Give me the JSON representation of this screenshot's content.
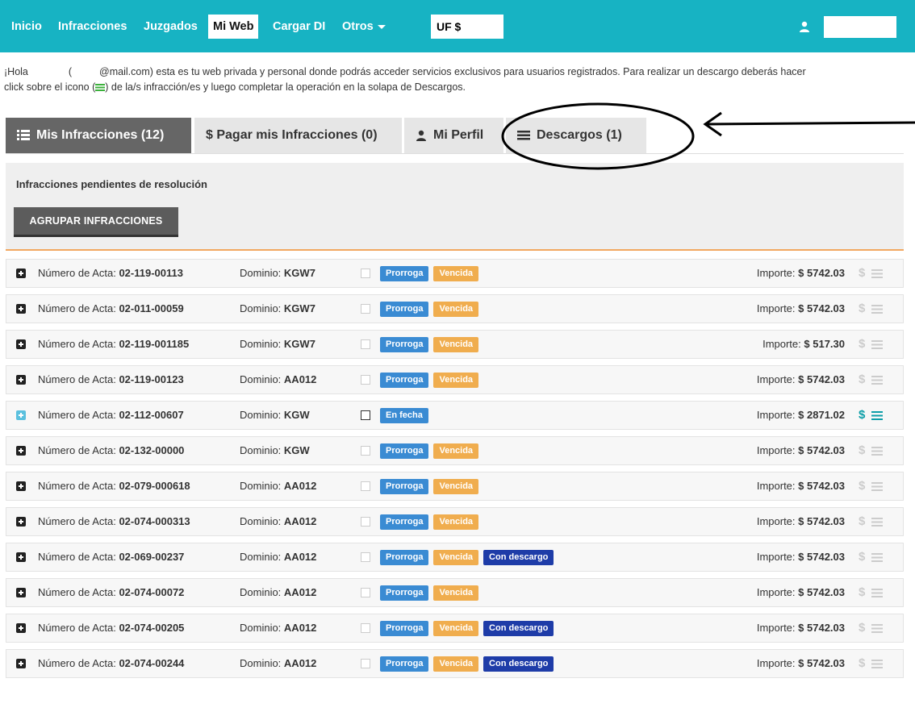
{
  "nav": {
    "items": [
      "Inicio",
      "Infracciones",
      "Juzgados",
      "Mi Web",
      "Cargar DI",
      "Otros"
    ],
    "uf_label": "UF $"
  },
  "intro": {
    "line1_a": "¡Hola",
    "line1_b": "(",
    "line1_c": "@mail.com) esta es tu web privada y personal donde podrás acceder servicios exclusivos para usuarios registrados. Para realizar un descargo deberás hacer",
    "line2_a": "click sobre el icono (",
    "line2_b": ") de la/s infracción/es y luego completar la operación en la solapa de Descargos."
  },
  "tabs": [
    {
      "label": "Mis Infracciones (12)"
    },
    {
      "label": "$ Pagar mis Infracciones (0)"
    },
    {
      "label": "Mi Perfil"
    },
    {
      "label": "Descargos (1)"
    }
  ],
  "panel": {
    "title": "Infracciones pendientes de resolución",
    "group_button": "AGRUPAR INFRACCIONES"
  },
  "labels": {
    "acta": "Número de Acta:",
    "dominio": "Dominio:",
    "importe": "Importe:"
  },
  "rows": [
    {
      "acta": "02-119-00113",
      "dominio": "KGW7",
      "badges": [
        "Prorroga",
        "Vencida"
      ],
      "importe": "$ 5742.03",
      "enabled": false
    },
    {
      "acta": "02-011-00059",
      "dominio": "KGW7",
      "badges": [
        "Prorroga",
        "Vencida"
      ],
      "importe": "$ 5742.03",
      "enabled": false
    },
    {
      "acta": "02-119-001185",
      "dominio": "KGW7",
      "badges": [
        "Prorroga",
        "Vencida"
      ],
      "importe": "$ 517.30",
      "enabled": false
    },
    {
      "acta": "02-119-00123",
      "dominio": "AA012",
      "badges": [
        "Prorroga",
        "Vencida"
      ],
      "importe": "$ 5742.03",
      "enabled": false
    },
    {
      "acta": "02-112-00607",
      "dominio": "KGW",
      "badges": [
        "En fecha"
      ],
      "importe": "$ 2871.02",
      "enabled": true
    },
    {
      "acta": "02-132-00000",
      "dominio": "KGW",
      "badges": [
        "Prorroga",
        "Vencida"
      ],
      "importe": "$ 5742.03",
      "enabled": false
    },
    {
      "acta": "02-079-000618",
      "dominio": "AA012",
      "badges": [
        "Prorroga",
        "Vencida"
      ],
      "importe": "$ 5742.03",
      "enabled": false
    },
    {
      "acta": "02-074-000313",
      "dominio": "AA012",
      "badges": [
        "Prorroga",
        "Vencida"
      ],
      "importe": "$ 5742.03",
      "enabled": false
    },
    {
      "acta": "02-069-00237",
      "dominio": "AA012",
      "badges": [
        "Prorroga",
        "Vencida",
        "Con descargo"
      ],
      "importe": "$ 5742.03",
      "enabled": false
    },
    {
      "acta": "02-074-00072",
      "dominio": "AA012",
      "badges": [
        "Prorroga",
        "Vencida"
      ],
      "importe": "$ 5742.03",
      "enabled": false
    },
    {
      "acta": "02-074-00205",
      "dominio": "AA012",
      "badges": [
        "Prorroga",
        "Vencida",
        "Con descargo"
      ],
      "importe": "$ 5742.03",
      "enabled": false
    },
    {
      "acta": "02-074-00244",
      "dominio": "AA012",
      "badges": [
        "Prorroga",
        "Vencida",
        "Con descargo"
      ],
      "importe": "$ 5742.03",
      "enabled": false
    }
  ],
  "colors": {
    "nav_bg": "#17b3c3",
    "prorroga": "#3a8bd3",
    "vencida": "#f0ad4e",
    "con_descargo": "#1e3ca8",
    "accent_teal": "#0d9ea8",
    "green_icon": "#3cb13c"
  },
  "icons": [
    "user-icon",
    "list-icon",
    "dollar-icon",
    "lines-icon",
    "plus-square-icon",
    "caret-down-icon"
  ]
}
